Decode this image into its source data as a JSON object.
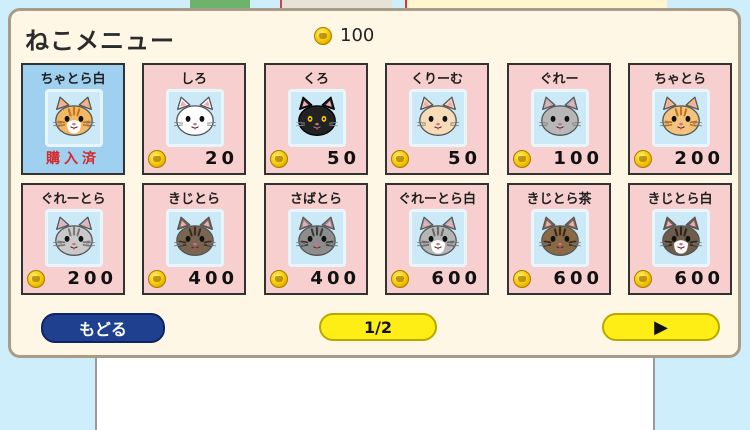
{
  "title": "ねこメニュー",
  "coins": "100",
  "cards": [
    {
      "name": "ちゃとら白",
      "price": "",
      "owned": true,
      "owned_label": "購入済",
      "fur": "#f2b865",
      "stripes": "#c4741f",
      "bib": true
    },
    {
      "name": "しろ",
      "price": "20",
      "owned": false,
      "fur": "#ffffff",
      "stripes": "",
      "bib": false
    },
    {
      "name": "くろ",
      "price": "50",
      "owned": false,
      "fur": "#222222",
      "stripes": "",
      "bib": false,
      "eyes": "#f2c200"
    },
    {
      "name": "くりーむ",
      "price": "50",
      "owned": false,
      "fur": "#f8dcb8",
      "stripes": "",
      "bib": false
    },
    {
      "name": "ぐれー",
      "price": "100",
      "owned": false,
      "fur": "#b7b7b7",
      "stripes": "",
      "bib": false
    },
    {
      "name": "ちゃとら",
      "price": "200",
      "owned": false,
      "fur": "#f4c47c",
      "stripes": "#c4741f",
      "bib": false
    },
    {
      "name": "ぐれーとら",
      "price": "200",
      "owned": false,
      "fur": "#c9c9c9",
      "stripes": "#7a7a7a",
      "bib": false
    },
    {
      "name": "きじとら",
      "price": "400",
      "owned": false,
      "fur": "#7a6550",
      "stripes": "#3a2d20",
      "bib": false
    },
    {
      "name": "さばとら",
      "price": "400",
      "owned": false,
      "fur": "#8d8d8d",
      "stripes": "#3b3b3b",
      "bib": false
    },
    {
      "name": "ぐれーとら白",
      "price": "600",
      "owned": false,
      "fur": "#b5b5b5",
      "stripes": "#6a6a6a",
      "bib": true
    },
    {
      "name": "きじとら茶",
      "price": "600",
      "owned": false,
      "fur": "#8a6a45",
      "stripes": "#3c2a18",
      "bib": false
    },
    {
      "name": "きじとら白",
      "price": "600",
      "owned": false,
      "fur": "#6f5d4c",
      "stripes": "#2e241b",
      "bib": true
    }
  ],
  "buttons": {
    "back": "もどる",
    "page": "1/2",
    "next": "▶"
  },
  "colors": {
    "panel": "#fff7e6",
    "card": "#f7cfcf",
    "card_owned": "#9fd0ef",
    "accent_yellow": "#ffee16",
    "back_button": "#1f3f8f"
  },
  "icons": {
    "coin": "coin-icon",
    "next": "play-arrow-icon"
  }
}
